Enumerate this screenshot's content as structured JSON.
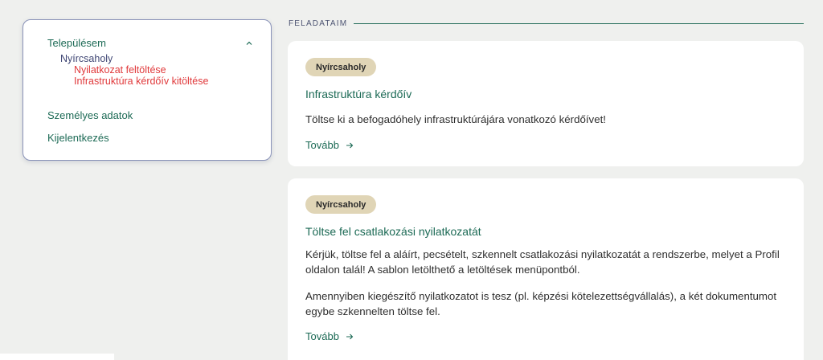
{
  "sidebar": {
    "town_label": "Településem",
    "city": "Nyírcsaholy",
    "sub_items": [
      "Nyilatkozat feltöltése",
      "Infrastruktúra kérdőív kitöltése"
    ],
    "personal_label": "Személyes adatok",
    "logout_label": "Kijelentkezés"
  },
  "section": {
    "title": "FELADATAIM"
  },
  "tasks": [
    {
      "badge": "Nyírcsaholy",
      "title": "Infrastruktúra kérdőív",
      "paragraphs": [
        "Töltse ki a befogadóhely infrastruktúrájára vonatkozó kérdőívet!"
      ],
      "more_label": "Tovább"
    },
    {
      "badge": "Nyírcsaholy",
      "title": "Töltse fel csatlakozási nyilatkozatát",
      "paragraphs": [
        "Kérjük, töltse fel a aláírt, pecsételt, szkennelt csatlakozási nyilatkozatát a rendszerbe, melyet a Profil oldalon talál! A sablon letölthető a letöltések menüpontból.",
        "Amennyiben kiegészítő nyilatkozatot is tesz (pl. képzési kötelezettségvállalás), a két dokumentumot egybe szkennelten töltse fel."
      ],
      "more_label": "Tovább"
    }
  ],
  "colors": {
    "accent": "#1c6a55",
    "link_red": "#e0393b",
    "badge_bg": "#e0d5b6",
    "page_bg": "#eff0ee"
  },
  "icons": {
    "collapse": "chevron-up-icon",
    "more": "arrow-right-icon"
  }
}
